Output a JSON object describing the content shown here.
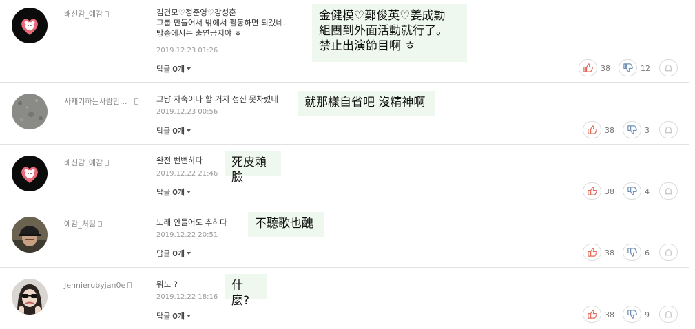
{
  "reply_label": "답글",
  "comments": [
    {
      "user": "배신감_예감",
      "avatar": "heart-bear-avatar",
      "text": "김건모♡정준영♡강성훈\n그룹 만들어서 밖에서 활동하면 되겠네.\n방송에서는 출연금지야 ㅎ",
      "date": "2019.12.23  01:26",
      "reply_count": "0개",
      "translation": "金健模♡鄭俊英♡姜成勳\n組團到外面活動就行了。\n禁止出演節目啊 ㅎ",
      "likes": "38",
      "dislikes": "12"
    },
    {
      "user": "사재기하는사람만...",
      "avatar": "gray-texture-avatar",
      "text": "그냥 자숙이나 할 거지 정신 못차렸네",
      "date": "2019.12.23  00:56",
      "reply_count": "0개",
      "translation": "就那樣自省吧 沒精神啊",
      "likes": "38",
      "dislikes": "3"
    },
    {
      "user": "배신감_예감",
      "avatar": "heart-bear-avatar",
      "text": "완전 뻔뻔하다",
      "date": "2019.12.22  21:46",
      "reply_count": "0개",
      "translation": "死皮賴臉",
      "likes": "38",
      "dislikes": "4"
    },
    {
      "user": "예감_처럼",
      "avatar": "man-cap-avatar",
      "text": "노래 안들어도 추하다",
      "date": "2019.12.22  20:51",
      "reply_count": "0개",
      "translation": "不聽歌也醜",
      "likes": "38",
      "dislikes": "6"
    },
    {
      "user": "Jennierubyjan0e",
      "avatar": "woman-sunglasses-avatar",
      "text": "뭐노 ?",
      "date": "2019.12.22  18:16",
      "reply_count": "0개",
      "translation": "什麼?",
      "likes": "38",
      "dislikes": "9"
    }
  ]
}
